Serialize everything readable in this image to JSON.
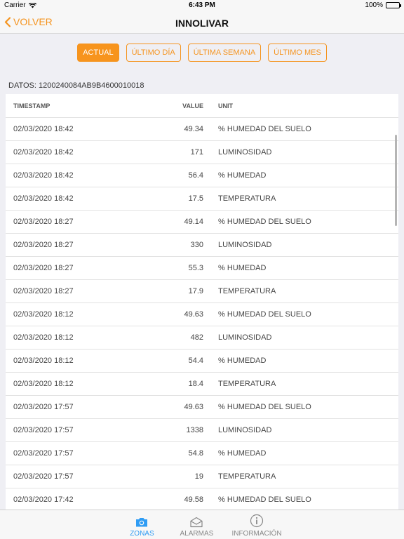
{
  "status_bar": {
    "carrier": "Carrier",
    "time": "6:43 PM",
    "battery": "100%"
  },
  "nav": {
    "back_label": "VOLVER",
    "title": "INNOLIVAR"
  },
  "filters": [
    {
      "label": "ACTUAL",
      "active": true
    },
    {
      "label": "ÚLTIMO DÍA",
      "active": false
    },
    {
      "label": "ÚLTIMA SEMANA",
      "active": false
    },
    {
      "label": "ÚLTIMO MES",
      "active": false
    }
  ],
  "datos": "DATOS: 1200240084AB9B4600010018",
  "table": {
    "headers": {
      "timestamp": "TIMESTAMP",
      "value": "VALUE",
      "unit": "UNIT"
    },
    "rows": [
      {
        "timestamp": "02/03/2020 18:42",
        "value": "49.34",
        "unit": "% HUMEDAD DEL SUELO"
      },
      {
        "timestamp": "02/03/2020 18:42",
        "value": "171",
        "unit": "LUMINOSIDAD"
      },
      {
        "timestamp": "02/03/2020 18:42",
        "value": "56.4",
        "unit": "% HUMEDAD"
      },
      {
        "timestamp": "02/03/2020 18:42",
        "value": "17.5",
        "unit": "TEMPERATURA"
      },
      {
        "timestamp": "02/03/2020 18:27",
        "value": "49.14",
        "unit": "% HUMEDAD DEL SUELO"
      },
      {
        "timestamp": "02/03/2020 18:27",
        "value": "330",
        "unit": "LUMINOSIDAD"
      },
      {
        "timestamp": "02/03/2020 18:27",
        "value": "55.3",
        "unit": "% HUMEDAD"
      },
      {
        "timestamp": "02/03/2020 18:27",
        "value": "17.9",
        "unit": "TEMPERATURA"
      },
      {
        "timestamp": "02/03/2020 18:12",
        "value": "49.63",
        "unit": "% HUMEDAD DEL SUELO"
      },
      {
        "timestamp": "02/03/2020 18:12",
        "value": "482",
        "unit": "LUMINOSIDAD"
      },
      {
        "timestamp": "02/03/2020 18:12",
        "value": "54.4",
        "unit": "% HUMEDAD"
      },
      {
        "timestamp": "02/03/2020 18:12",
        "value": "18.4",
        "unit": "TEMPERATURA"
      },
      {
        "timestamp": "02/03/2020 17:57",
        "value": "49.63",
        "unit": "% HUMEDAD DEL SUELO"
      },
      {
        "timestamp": "02/03/2020 17:57",
        "value": "1338",
        "unit": "LUMINOSIDAD"
      },
      {
        "timestamp": "02/03/2020 17:57",
        "value": "54.8",
        "unit": "% HUMEDAD"
      },
      {
        "timestamp": "02/03/2020 17:57",
        "value": "19",
        "unit": "TEMPERATURA"
      },
      {
        "timestamp": "02/03/2020 17:42",
        "value": "49.58",
        "unit": "% HUMEDAD DEL SUELO"
      }
    ]
  },
  "tab_bar": [
    {
      "label": "ZONAS",
      "icon": "camera-icon",
      "active": true
    },
    {
      "label": "ALARMAS",
      "icon": "envelope-icon",
      "active": false
    },
    {
      "label": "INFORMACIÓN",
      "icon": "info-icon",
      "active": false
    }
  ],
  "colors": {
    "accent": "#f7941d",
    "tab_active": "#2f9cf4",
    "tab_inactive": "#888888"
  }
}
